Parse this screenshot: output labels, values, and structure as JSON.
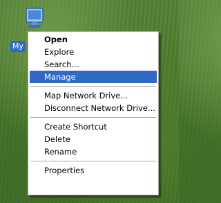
{
  "desktop": {
    "icon_name": "my-network-places-icon",
    "icon_label": "My"
  },
  "context_menu": {
    "groups": [
      [
        {
          "label": "Open",
          "bold": true
        },
        {
          "label": "Explore"
        },
        {
          "label": "Search..."
        },
        {
          "label": "Manage",
          "highlighted": true
        }
      ],
      [
        {
          "label": "Map Network Drive..."
        },
        {
          "label": "Disconnect Network Drive..."
        }
      ],
      [
        {
          "label": "Create Shortcut"
        },
        {
          "label": "Delete"
        },
        {
          "label": "Rename"
        }
      ],
      [
        {
          "label": "Properties"
        }
      ]
    ],
    "highlight_color": "#316ac5",
    "separator_color": "#aca899"
  }
}
